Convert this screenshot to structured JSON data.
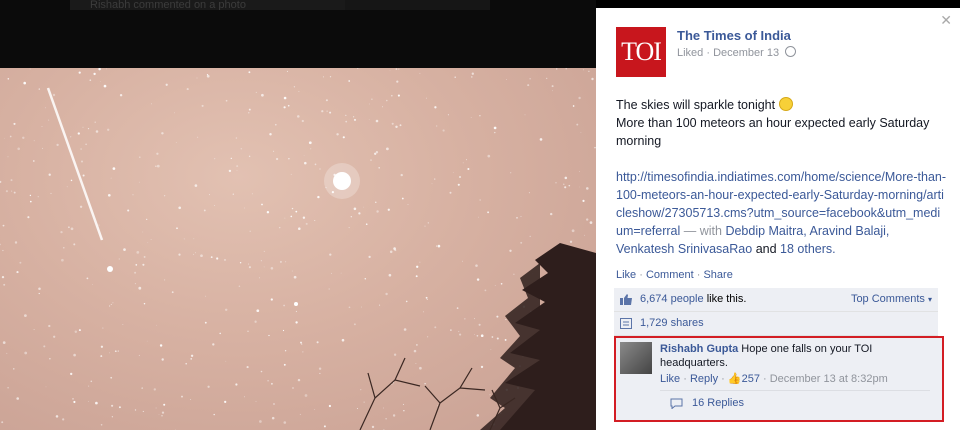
{
  "background": {
    "notification_text": "Rishabh commented on a photo"
  },
  "post": {
    "page_name": "The Times of India",
    "avatar_text": "TOI",
    "liked_label": "Liked",
    "date": "December 13",
    "line1": "The skies will sparkle tonight",
    "line2": "More than 100 meteors an hour expected early Saturday morning",
    "url": "http://timesofindia.indiatimes.com/home/science/More-than-100-meteors-an-hour-expected-early-Saturday-morning/articleshow/27305713.cms?utm_source=facebook&utm_medium=referral",
    "with_label": "— with",
    "tagged": "Debdip Maitra, Aravind Balaji, Venkatesh SrinivasaRao",
    "and_label": "and",
    "others": "18 others."
  },
  "actions": {
    "like": "Like",
    "comment": "Comment",
    "share": "Share"
  },
  "stats": {
    "likes_count": "6,674 people",
    "likes_suffix": "like this.",
    "top_comments": "Top Comments",
    "shares": "1,729 shares"
  },
  "comment": {
    "author": "Rishabh Gupta",
    "text": "Hope one falls on your TOI headquarters.",
    "like": "Like",
    "reply": "Reply",
    "like_count": "257",
    "timestamp": "December 13 at 8:32pm",
    "replies": "16 Replies"
  },
  "colors": {
    "link": "#3b5998",
    "highlight_border": "#d31d24",
    "toi_red": "#c8161d"
  }
}
